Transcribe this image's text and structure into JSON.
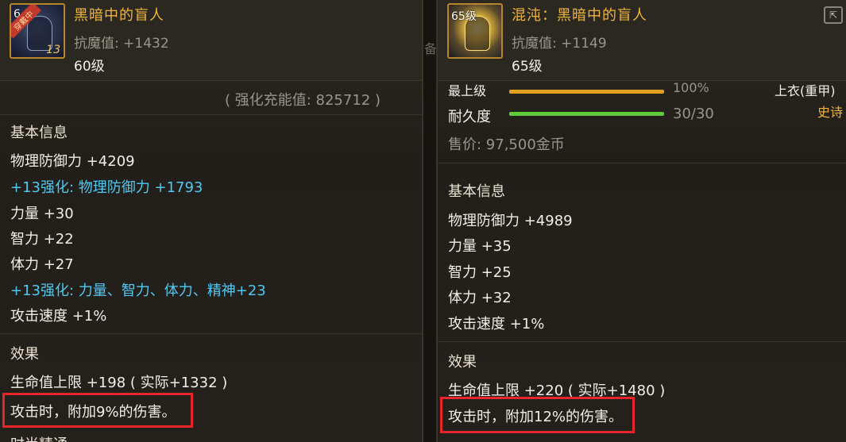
{
  "left": {
    "icon": {
      "name": "helmet-icon",
      "tag": "6",
      "ribbon": "穿戴中",
      "badge": "13"
    },
    "name": "黑暗中的盲人",
    "resist": "抗魔值: +1432",
    "level": "60级",
    "charge": "( 强化充能值: 825712 )",
    "section_basic": "基本信息",
    "stats": [
      "物理防御力 +4209",
      "+13强化: 物理防御力 +1793",
      "力量 +30",
      "智力 +22",
      "体力 +27",
      "+13强化: 力量、智力、体力、精神+23",
      "攻击速度 +1%"
    ],
    "section_effect": "效果",
    "effects": [
      "生命值上限 +198 ( 实际+1332 )",
      "攻击时，附加9%的伤害。"
    ],
    "section_next": "时尚精通"
  },
  "right": {
    "icon": {
      "name": "helmet-icon",
      "tag": "65级"
    },
    "name": "混沌：黑暗中的盲人",
    "resist": "抗魔值: +1149",
    "level": "65级",
    "cut_label": "最上级",
    "cut_value": "100%",
    "cut_type": "上衣(重甲)",
    "rarity": "史诗",
    "durability_label": "耐久度",
    "durability_value": "30/30",
    "durability_fraction": 1.0,
    "price": "售价: 97,500金币",
    "section_basic": "基本信息",
    "stats": [
      "物理防御力 +4989",
      "力量 +35",
      "智力 +25",
      "体力 +32",
      "攻击速度 +1%"
    ],
    "section_effect": "效果",
    "effects": [
      "生命值上限 +220 ( 实际+1480 )",
      "攻击时，附加12%的伤害。"
    ]
  },
  "gap_glyph": "备",
  "colors": {
    "highlight": "#e8262a",
    "enhance": "#52c8f0",
    "name": "#f0b43c"
  }
}
